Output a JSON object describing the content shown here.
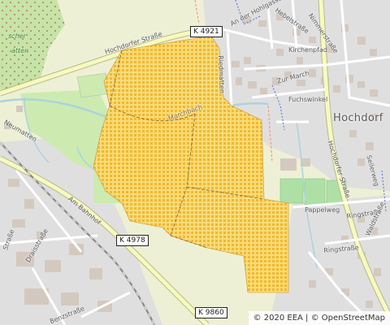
{
  "map": {
    "colors": {
      "background": "#eef0d5",
      "residential": "#e0dfdf",
      "building": "#d4c9bf",
      "park": "#cdebb0",
      "water": "#aad3df",
      "road": "#ffffff",
      "major_road": "#f7fabf",
      "rail": "#999999",
      "flood_hatch": "#f2b82e",
      "flood_fill": "#f7dc7a"
    },
    "road_shields": {
      "k4921": "K 4921",
      "k4978": "K 4978",
      "k9860": "K 9860"
    },
    "labels": {
      "hochdorfer_strasse_north": "Hochdorfer Straße",
      "an_der_hohlgasse": "An der Hohlgasse",
      "im_oberen": "Hebelstraße",
      "nimmerstrasse": "Nimmerstraße",
      "kirchenpfad": "Kirchenpfad",
      "riedmatten": "Riedmatten",
      "zur_march": "Zur March",
      "fuchswinkel": "Fuchswinkel",
      "hochdorf": "Hochdorf",
      "marchbach": "Marchbach",
      "neumatten": "Neumatten",
      "am_bahnhof": "Am Bahnhof",
      "hochdorfer_strasse_east": "Hochdorfer Straße",
      "pappelweg": "Pappelweg",
      "ringstrasse": "Ringstraße",
      "seilerweg": "Seilerweg",
      "waldstrasse": "Waldstraße",
      "ringstrasse_south": "Ringstraße",
      "draisstrasse": "Draisstraße",
      "benzstrasse": "Benzstraße",
      "strasse_left": "Straße",
      "fischer_matten": "scher",
      "matten": "atten"
    },
    "attribution": {
      "eea": "© 2020 EEA",
      "separator": "|",
      "osm": "© OpenStreetMap"
    }
  }
}
